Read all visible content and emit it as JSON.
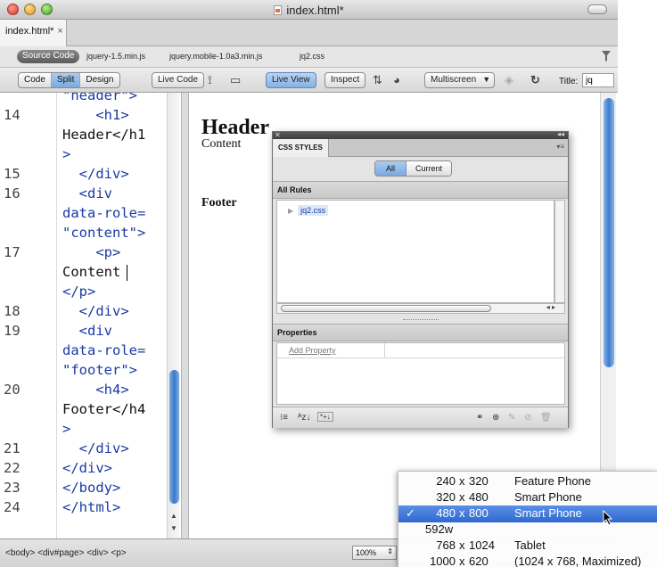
{
  "window": {
    "title": "index.html*"
  },
  "doc_tab": {
    "label": "index.html*",
    "close": "×"
  },
  "related_files": {
    "source_label": "Source Code",
    "files": [
      "jquery-1.5.min.js",
      "jquery.mobile-1.0a3.min.js",
      "jq2.css"
    ]
  },
  "toolbar": {
    "view_modes": [
      "Code",
      "Split",
      "Design"
    ],
    "active_view": "Split",
    "live_code": "Live Code",
    "live_view": "Live View",
    "inspect": "Inspect",
    "multiscreen": "Multiscreen",
    "title_label": "Title:",
    "title_value": "jq"
  },
  "code": {
    "lines": [
      {
        "num": "",
        "text": "\"header\">"
      },
      {
        "num": "14",
        "text": "    <h1>"
      },
      {
        "num": "",
        "text": "Header</h1"
      },
      {
        "num": "",
        "text": ">"
      },
      {
        "num": "15",
        "text": "  </div>"
      },
      {
        "num": "16",
        "text": "  <div"
      },
      {
        "num": "",
        "text": "data-role="
      },
      {
        "num": "",
        "text": "\"content\">"
      },
      {
        "num": "17",
        "text": "    <p>"
      },
      {
        "num": "",
        "text": "Content"
      },
      {
        "num": "",
        "text": "</p>"
      },
      {
        "num": "18",
        "text": "  </div>"
      },
      {
        "num": "19",
        "text": "  <div"
      },
      {
        "num": "",
        "text": "data-role="
      },
      {
        "num": "",
        "text": "\"footer\">"
      },
      {
        "num": "20",
        "text": "    <h4>"
      },
      {
        "num": "",
        "text": "Footer</h4"
      },
      {
        "num": "",
        "text": ">"
      },
      {
        "num": "21",
        "text": "  </div>"
      },
      {
        "num": "22",
        "text": "</div>"
      },
      {
        "num": "23",
        "text": "</body>"
      },
      {
        "num": "24",
        "text": "</html>"
      }
    ]
  },
  "design": {
    "header": "Header",
    "content": "Content",
    "footer": "Footer"
  },
  "css_panel": {
    "tab": "CSS STYLES",
    "seg_all": "All",
    "seg_current": "Current",
    "all_rules": "All Rules",
    "rule": "jq2.css",
    "properties": "Properties",
    "add_property": "Add Property"
  },
  "status": {
    "tag_selector": "<body> <div#page> <div> <p>",
    "zoom": "100%"
  },
  "multiscreen_menu": {
    "items": [
      {
        "w": "240",
        "h": "320",
        "device": "Feature Phone",
        "checked": false
      },
      {
        "w": "320",
        "h": "480",
        "device": "Smart Phone",
        "checked": false
      },
      {
        "w": "480",
        "h": "800",
        "device": "Smart Phone",
        "checked": true
      },
      {
        "w": "592w",
        "h": "",
        "device": "",
        "checked": false
      },
      {
        "w": "768",
        "h": "1024",
        "device": "Tablet",
        "checked": false
      },
      {
        "w": "1000",
        "h": "620",
        "device": "(1024 x 768, Maximized)",
        "checked": false
      }
    ],
    "times": "x",
    "check": "✓"
  },
  "colors": {
    "tag_blue": "#1a3aa6",
    "menu_highlight": "#2e68cf",
    "live_blue": "#86b1e3"
  }
}
